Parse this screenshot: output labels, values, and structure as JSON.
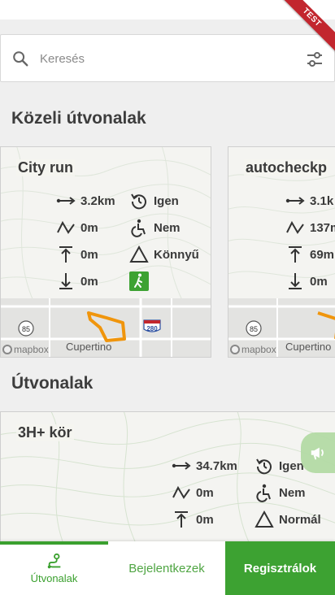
{
  "debug_banner": "TEST",
  "search": {
    "placeholder": "Keresés"
  },
  "nearby": {
    "title": "Közeli útvonalak",
    "cards": [
      {
        "name": "City run",
        "distance": "3.2km",
        "loop": "Igen",
        "elevation": "0m",
        "accessible": "Nem",
        "ascent": "0m",
        "difficulty": "Könnyű",
        "descent": "0m",
        "map_labels": {
          "highway_a": "85",
          "highway_b": "280",
          "city": "Cupertino",
          "attribution": "mapbox"
        }
      },
      {
        "name": "autocheckp",
        "distance": "3.1k",
        "elevation": "137m",
        "ascent": "69m",
        "descent": "0m",
        "map_labels": {
          "highway_a": "85",
          "city": "Cupertino",
          "attribution": "mapbox"
        }
      }
    ]
  },
  "routes": {
    "title": "Útvonalak",
    "cards": [
      {
        "name": "3H+ kör",
        "distance": "34.7km",
        "loop": "Igen",
        "elevation": "0m",
        "accessible": "Nem",
        "ascent": "0m",
        "difficulty": "Normál"
      }
    ]
  },
  "bottom_nav": {
    "routes_label": "Útvonalak",
    "login_label": "Bejelentkezek",
    "register_label": "Regisztrálok"
  },
  "colors": {
    "accent": "#3da232",
    "route_line": "#f0950c"
  }
}
